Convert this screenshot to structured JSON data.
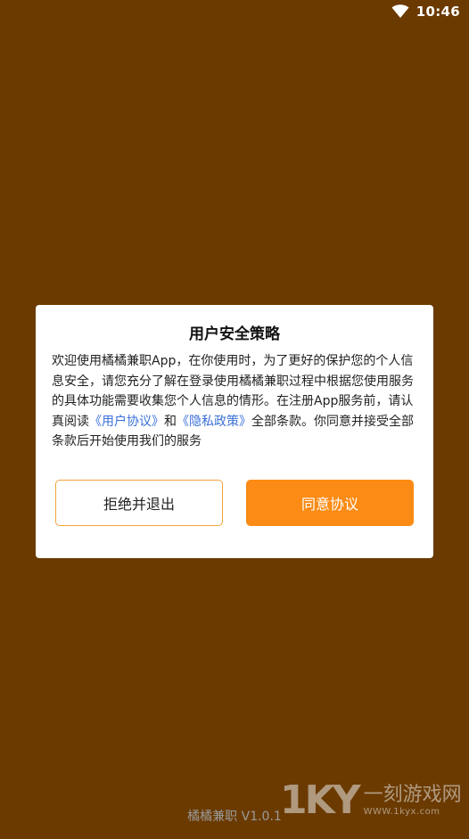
{
  "status_bar": {
    "time": "10:46",
    "wifi_icon": "wifi-icon"
  },
  "dialog": {
    "title": "用户安全策略",
    "body_part1": "欢迎使用橘橘兼职App，在你使用时，为了更好的保护您的个人信息安全，请您充分了解在登录使用橘橘兼职过程中根据您使用服务的具体功能需要收集您个人信息的情形。在注册App服务前，请认真阅读",
    "link_user_agreement": "《用户协议》",
    "body_and": "和",
    "link_privacy_policy": "《隐私政策》",
    "body_part2": "全部条款。你同意并接受全部条款后开始使用我们的服务",
    "reject_label": "拒绝并退出",
    "agree_label": "同意协议"
  },
  "footer": {
    "version": "橘橘兼职 V1.0.1"
  },
  "watermark": {
    "logo": "1KY",
    "name": "一刻游戏网",
    "url": "WWW.1kyx.com"
  },
  "colors": {
    "background": "#6b3a00",
    "accent": "#fb8b14",
    "link": "#3a6fd8"
  }
}
